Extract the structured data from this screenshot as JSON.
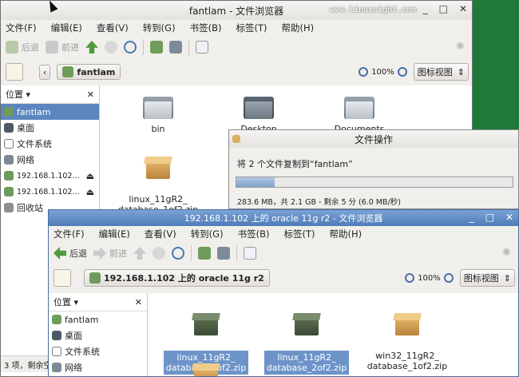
{
  "watermark": "www.linuxsight.com",
  "win1": {
    "title": "fantlam - 文件浏览器",
    "menu": [
      "文件(F)",
      "编辑(E)",
      "查看(V)",
      "转到(G)",
      "书签(B)",
      "标签(T)",
      "帮助(H)"
    ],
    "toolbar": {
      "back": "后退",
      "forward": "前进"
    },
    "path": "fantlam",
    "zoom": "100%",
    "view": "图标视图",
    "sidebar_head": "位置",
    "sidebar": [
      "fantlam",
      "桌面",
      "文件系统",
      "网络",
      "192.168.1.102…",
      "192.168.1.102…",
      "回收站"
    ],
    "files": [
      {
        "name": "bin"
      },
      {
        "name": "Desktop"
      },
      {
        "name": "Documents"
      },
      {
        "name": "linux_11gR2_\ndatabase_1of2.zip"
      }
    ],
    "status": "3 项，剩余空"
  },
  "ops": {
    "title": "文件操作",
    "msg": "将 2 个文件复制到“fantlam”",
    "progress": 0.14,
    "detail": "283.6 MB，共 2.1 GB - 剩余 5 分 (6.0 MB/秒)"
  },
  "win2": {
    "title": "192.168.1.102 上的 oracle 11g r2 - 文件浏览器",
    "menu": [
      "文件(F)",
      "编辑(E)",
      "查看(V)",
      "转到(G)",
      "书签(B)",
      "标签(T)",
      "帮助(H)"
    ],
    "toolbar": {
      "back": "后退",
      "forward": "前进"
    },
    "path": "192.168.1.102 上的 oracle 11g r2",
    "zoom": "100%",
    "view": "图标视图",
    "sidebar_head": "位置",
    "sidebar": [
      "fantlam",
      "桌面",
      "文件系统",
      "网络"
    ],
    "files": [
      {
        "name": "linux_11gR2_\ndatabase_1of2.zip"
      },
      {
        "name": "linux_11gR2_\ndatabase_2of2.zip"
      },
      {
        "name": "win32_11gR2_\ndatabase_1of2.zip"
      }
    ]
  },
  "colors": {
    "desktop": "#1f7a3a",
    "accent": "#5c86c0",
    "titlebar_active": "#5b87bf"
  }
}
